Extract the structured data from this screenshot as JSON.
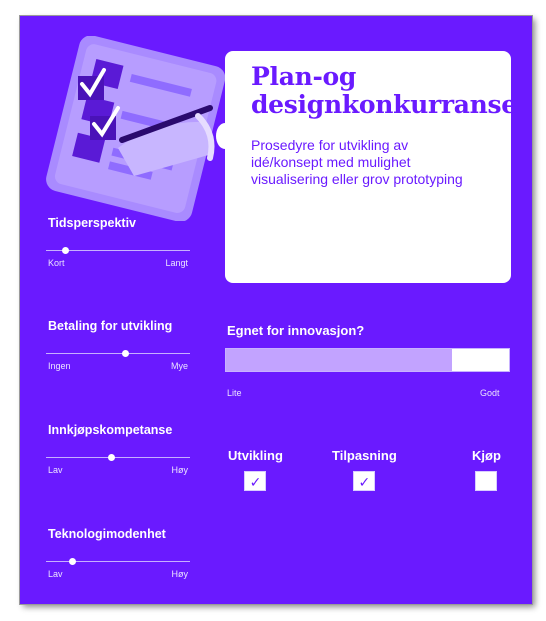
{
  "colors": {
    "primary": "#6a1aff"
  },
  "info": {
    "title": "Plan-og designkonkurranse",
    "description": "Prosedyre for utvikling av idé/konsept med mulighet visualisering eller grov prototyping"
  },
  "sliders": [
    {
      "title": "Tidsperspektiv",
      "min_label": "Kort",
      "max_label": "Langt",
      "value": 0.13
    },
    {
      "title": "Betaling for utvikling",
      "min_label": "Ingen",
      "max_label": "Mye",
      "value": 0.55
    },
    {
      "title": "Innkjøpskompetanse",
      "min_label": "Lav",
      "max_label": "Høy",
      "value": 0.45
    },
    {
      "title": "Teknologimodenhet",
      "min_label": "Lav",
      "max_label": "Høy",
      "value": 0.18
    }
  ],
  "innovation": {
    "title": "Egnet for innovasjon?",
    "min_label": "Lite",
    "max_label": "Godt",
    "value": 0.8
  },
  "flags": [
    {
      "label": "Utvikling",
      "checked": true
    },
    {
      "label": "Tilpasning",
      "checked": true
    },
    {
      "label": "Kjøp",
      "checked": false
    }
  ],
  "check_symbol": "✓",
  "illustration": {
    "icon": "checklist-pen-icon"
  }
}
